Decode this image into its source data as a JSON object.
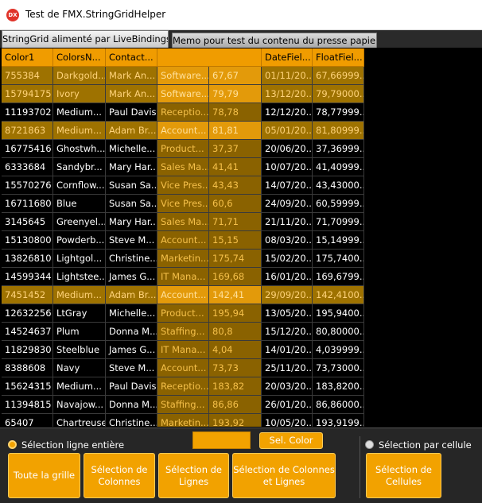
{
  "window": {
    "title": "Test de FMX.StringGridHelper",
    "icon": "DX"
  },
  "tabs": [
    {
      "label": "StringGrid alimenté par LiveBindings"
    },
    {
      "label": "Memo pour test du contenu du presse papier"
    }
  ],
  "grid": {
    "columns": [
      "Color1",
      "ColorsN...",
      "Contact...",
      "",
      "",
      "DateFiel...",
      "FloatFiel..."
    ],
    "rows": [
      {
        "cells": [
          "755384",
          "Darkgold...",
          "Mark An...",
          "Software...",
          "67,67",
          "01/11/20...",
          "67,66999..."
        ],
        "selected": true
      },
      {
        "cells": [
          "15794175",
          "Ivory",
          "Mark An...",
          "Software...",
          "79,79",
          "13/12/20...",
          "79,79000..."
        ],
        "selected": true
      },
      {
        "cells": [
          "11193702",
          "Medium...",
          "Paul Davis",
          "Receptio...",
          "78,78",
          "12/12/20...",
          "78,77999..."
        ],
        "selected": false
      },
      {
        "cells": [
          "8721863",
          "Medium...",
          "Adam Br...",
          "Account...",
          "81,81",
          "05/01/20...",
          "81,80999..."
        ],
        "selected": true
      },
      {
        "cells": [
          "16775416",
          "Ghostwh...",
          "Michelle...",
          "Product...",
          "37,37",
          "20/06/20...",
          "37,36999..."
        ],
        "selected": false
      },
      {
        "cells": [
          "6333684",
          "Sandybr...",
          "Mary Har...",
          "Sales Ma...",
          "41,41",
          "10/07/20...",
          "41,40999..."
        ],
        "selected": false
      },
      {
        "cells": [
          "15570276",
          "Cornflow...",
          "Susan Sa...",
          "Vice Pres...",
          "43,43",
          "14/07/20...",
          "43,43000..."
        ],
        "selected": false
      },
      {
        "cells": [
          "16711680",
          "Blue",
          "Susan Sa...",
          "Vice Pres...",
          "60,6",
          "24/09/20...",
          "60,59999..."
        ],
        "selected": false
      },
      {
        "cells": [
          "3145645",
          "Greenyel...",
          "Mary Har...",
          "Sales Ma...",
          "71,71",
          "21/11/20...",
          "71,70999..."
        ],
        "selected": false
      },
      {
        "cells": [
          "15130800",
          "Powderb...",
          "Steve M...",
          "Account...",
          "15,15",
          "08/03/20...",
          "15,14999..."
        ],
        "selected": false
      },
      {
        "cells": [
          "13826810",
          "Lightgol...",
          "Christine...",
          "Marketin...",
          "175,74",
          "15/02/20...",
          "175,7400..."
        ],
        "selected": false
      },
      {
        "cells": [
          "14599344",
          "Lightstee...",
          "James G...",
          "IT Mana...",
          "169,68",
          "16/01/20...",
          "169,6799..."
        ],
        "selected": false
      },
      {
        "cells": [
          "7451452",
          "Medium...",
          "Adam Br...",
          "Account...",
          "142,41",
          "29/09/20...",
          "142,4100..."
        ],
        "selected": true
      },
      {
        "cells": [
          "12632256",
          "LtGray",
          "Michelle...",
          "Product...",
          "195,94",
          "13/05/20...",
          "195,9400..."
        ],
        "selected": false
      },
      {
        "cells": [
          "14524637",
          "Plum",
          "Donna M...",
          "Staffing...",
          "80,8",
          "15/12/20...",
          "80,80000..."
        ],
        "selected": false
      },
      {
        "cells": [
          "11829830",
          "Steelblue",
          "James G...",
          "IT Mana...",
          "4,04",
          "14/01/20...",
          "4,039999..."
        ],
        "selected": false
      },
      {
        "cells": [
          "8388608",
          "Navy",
          "Steve M...",
          "Account...",
          "73,73",
          "25/11/20...",
          "73,73000..."
        ],
        "selected": false
      },
      {
        "cells": [
          "15624315",
          "Medium...",
          "Paul Davis",
          "Receptio...",
          "183,82",
          "20/03/20...",
          "183,8200..."
        ],
        "selected": false
      },
      {
        "cells": [
          "11394815",
          "Navajow...",
          "Donna M...",
          "Staffing...",
          "86,86",
          "26/01/20...",
          "86,86000..."
        ],
        "selected": false
      },
      {
        "cells": [
          "65407",
          "Chartreuse",
          "Christine...",
          "Marketin...",
          "193,92",
          "10/05/20...",
          "193,9199..."
        ],
        "selected": false
      }
    ]
  },
  "bottom": {
    "radio_row": {
      "label": "Sélection ligne entière",
      "checked": true
    },
    "radio_cell": {
      "label": "Sélection par cellule",
      "checked": false
    },
    "color_swatch": "#f2a200",
    "sel_color_button": "Sel. Color",
    "buttons": {
      "all": "Toute la grille",
      "columns": "Sélection de Colonnes",
      "rows": "Sélection de Lignes",
      "cols_rows": "Sélection de Colonnes et Lignes",
      "cells": "Sélection de Cellules"
    }
  },
  "colors": {
    "accent": "#f2a200",
    "header": "#f09c00",
    "highlight_col": "#8a6200"
  }
}
